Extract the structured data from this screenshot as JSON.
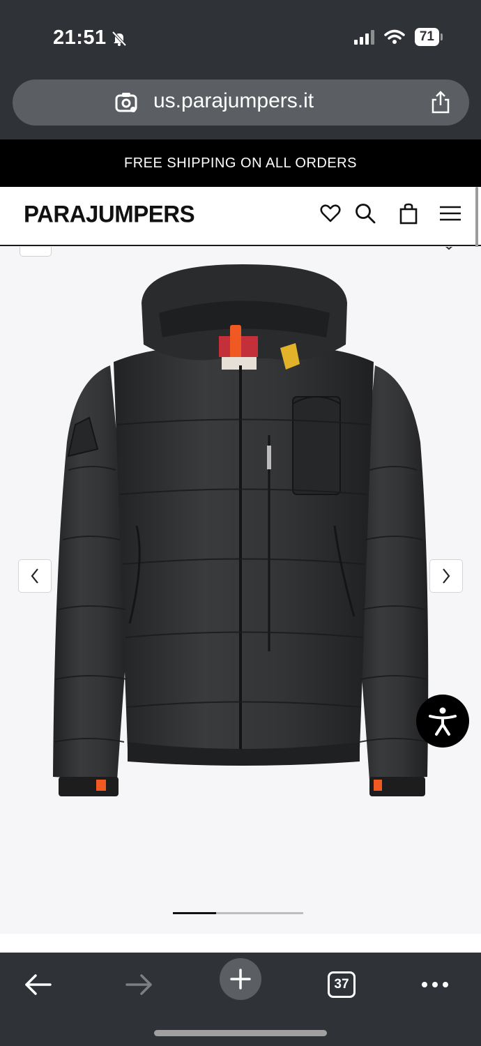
{
  "status_bar": {
    "time": "21:51",
    "battery": "71"
  },
  "browser": {
    "url": "us.parajumpers.it",
    "tab_count": "37"
  },
  "promo_banner": {
    "text": "FREE SHIPPING ON ALL ORDERS"
  },
  "site_header": {
    "logo": "PARAJUMPERS",
    "icons": [
      "heart-icon",
      "search-icon",
      "bag-icon",
      "menu-icon"
    ]
  },
  "gallery": {
    "image_alt": "Black hooded down jacket",
    "progress_fraction": 0.33
  },
  "colors": {
    "chrome": "#2f3236",
    "url_bar": "#5b5f63",
    "banner": "#000000",
    "jacket": "#2b2c2d",
    "accent_orange": "#f05a22",
    "accent_yellow": "#e2b32a"
  }
}
